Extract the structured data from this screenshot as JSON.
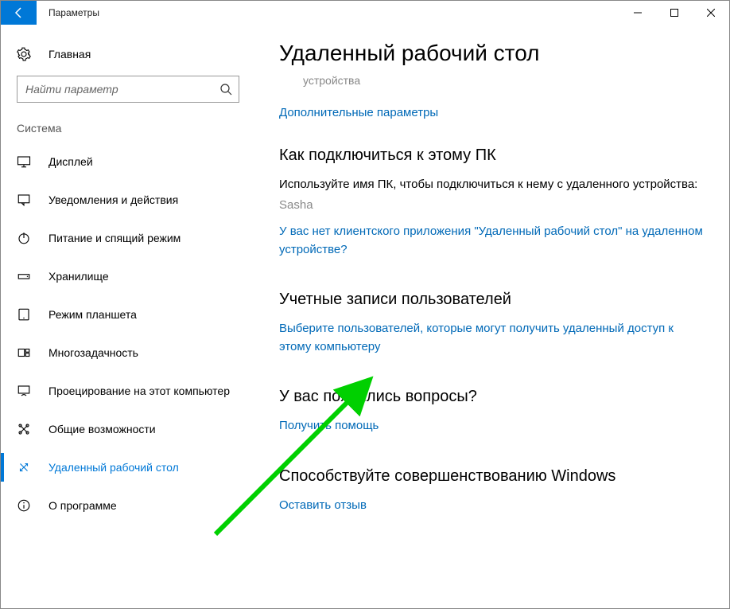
{
  "window": {
    "title": "Параметры"
  },
  "sidebar": {
    "home": "Главная",
    "search_placeholder": "Найти параметр",
    "category": "Система",
    "items": [
      {
        "label": "Дисплей"
      },
      {
        "label": "Уведомления и действия"
      },
      {
        "label": "Питание и спящий режим"
      },
      {
        "label": "Хранилище"
      },
      {
        "label": "Режим планшета"
      },
      {
        "label": "Многозадачность"
      },
      {
        "label": "Проецирование на этот компьютер"
      },
      {
        "label": "Общие возможности"
      },
      {
        "label": "Удаленный рабочий стол"
      },
      {
        "label": "О программе"
      }
    ]
  },
  "content": {
    "title": "Удаленный рабочий стол",
    "sub_gray": "устройства",
    "adv_link": "Дополнительные параметры",
    "connect": {
      "heading": "Как подключиться к этому ПК",
      "instruction": "Используйте имя ПК, чтобы подключиться к нему с удаленного устройства:",
      "pc_name": "Sasha",
      "no_client_link": "У вас нет клиентского приложения \"Удаленный рабочий стол\" на удаленном устройстве?"
    },
    "accounts": {
      "heading": "Учетные записи пользователей",
      "select_link": "Выберите пользователей, которые могут получить удаленный доступ к этому компьютеру"
    },
    "help": {
      "heading": "У вас появились вопросы?",
      "link": "Получить помощь"
    },
    "feedback": {
      "heading": "Способствуйте совершенствованию Windows",
      "link": "Оставить отзыв"
    }
  }
}
